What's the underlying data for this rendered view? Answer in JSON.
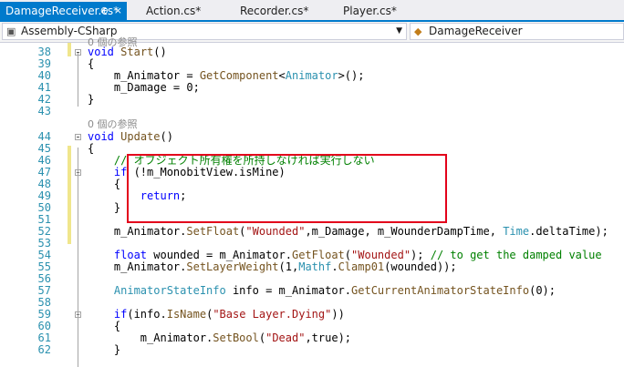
{
  "tabs": [
    {
      "label": "DamageReceiver.cs*",
      "active": true,
      "pin": "⊕",
      "close": "×"
    },
    {
      "label": "Action.cs*",
      "active": false
    },
    {
      "label": "Recorder.cs*",
      "active": false
    },
    {
      "label": "Player.cs*",
      "active": false
    }
  ],
  "nav": {
    "project": "Assembly-CSharp",
    "project_icon": "csharp-project-icon",
    "class": "DamageReceiver",
    "class_icon": "class-icon"
  },
  "colors": {
    "accent": "#007acc",
    "highlight_box": "#e3001b",
    "comment": "#008000",
    "keyword": "#0000ff",
    "type": "#2b91af",
    "string": "#a31515",
    "line_number": "#2b91af"
  },
  "editor": {
    "top_partial": "0 個の参照",
    "lines": [
      {
        "n": "38",
        "tokens": [
          {
            "t": "void",
            "c": "kw"
          },
          {
            "t": " "
          },
          {
            "t": "Start",
            "c": "mt"
          },
          {
            "t": "()"
          }
        ]
      },
      {
        "n": "39",
        "tokens": [
          {
            "t": "{"
          }
        ]
      },
      {
        "n": "40",
        "tokens": [
          {
            "t": "    m_Animator = "
          },
          {
            "t": "GetComponent",
            "c": "mt"
          },
          {
            "t": "<"
          },
          {
            "t": "Animator",
            "c": "ty"
          },
          {
            "t": ">();"
          }
        ]
      },
      {
        "n": "41",
        "tokens": [
          {
            "t": "    m_Damage = 0;"
          }
        ]
      },
      {
        "n": "42",
        "tokens": [
          {
            "t": "}"
          }
        ]
      },
      {
        "n": "43",
        "tokens": []
      },
      {
        "n": "",
        "ref": "0 個の参照"
      },
      {
        "n": "44",
        "tokens": [
          {
            "t": "void",
            "c": "kw"
          },
          {
            "t": " "
          },
          {
            "t": "Update",
            "c": "mt"
          },
          {
            "t": "()"
          }
        ]
      },
      {
        "n": "45",
        "tokens": [
          {
            "t": "{"
          }
        ]
      },
      {
        "n": "46",
        "tokens": [
          {
            "t": "    "
          },
          {
            "t": "// オブジェクト所有権を所持しなければ実行しない",
            "c": "cm"
          }
        ]
      },
      {
        "n": "47",
        "tokens": [
          {
            "t": "    "
          },
          {
            "t": "if",
            "c": "kw"
          },
          {
            "t": " (!m_MonobitView.isMine)"
          }
        ]
      },
      {
        "n": "48",
        "tokens": [
          {
            "t": "    {"
          }
        ]
      },
      {
        "n": "49",
        "tokens": [
          {
            "t": "        "
          },
          {
            "t": "return",
            "c": "kw"
          },
          {
            "t": ";"
          }
        ]
      },
      {
        "n": "50",
        "tokens": [
          {
            "t": "    }"
          }
        ]
      },
      {
        "n": "51",
        "tokens": []
      },
      {
        "n": "52",
        "tokens": [
          {
            "t": "    m_Animator."
          },
          {
            "t": "SetFloat",
            "c": "mt"
          },
          {
            "t": "("
          },
          {
            "t": "\"Wounded\"",
            "c": "st"
          },
          {
            "t": ",m_Damage, m_WounderDampTime, "
          },
          {
            "t": "Time",
            "c": "ty"
          },
          {
            "t": ".deltaTime);"
          }
        ]
      },
      {
        "n": "53",
        "tokens": []
      },
      {
        "n": "54",
        "tokens": [
          {
            "t": "    "
          },
          {
            "t": "float",
            "c": "kw"
          },
          {
            "t": " wounded = m_Animator."
          },
          {
            "t": "GetFloat",
            "c": "mt"
          },
          {
            "t": "("
          },
          {
            "t": "\"Wounded\"",
            "c": "st"
          },
          {
            "t": "); "
          },
          {
            "t": "// to get the damped value",
            "c": "cm"
          }
        ]
      },
      {
        "n": "55",
        "tokens": [
          {
            "t": "    m_Animator."
          },
          {
            "t": "SetLayerWeight",
            "c": "mt"
          },
          {
            "t": "(1,"
          },
          {
            "t": "Mathf",
            "c": "ty"
          },
          {
            "t": "."
          },
          {
            "t": "Clamp01",
            "c": "mt"
          },
          {
            "t": "(wounded));"
          }
        ]
      },
      {
        "n": "56",
        "tokens": []
      },
      {
        "n": "57",
        "tokens": [
          {
            "t": "    "
          },
          {
            "t": "AnimatorStateInfo",
            "c": "ty"
          },
          {
            "t": " info = m_Animator."
          },
          {
            "t": "GetCurrentAnimatorStateInfo",
            "c": "mt"
          },
          {
            "t": "(0);"
          }
        ]
      },
      {
        "n": "58",
        "tokens": []
      },
      {
        "n": "59",
        "tokens": [
          {
            "t": "    "
          },
          {
            "t": "if",
            "c": "kw"
          },
          {
            "t": "(info."
          },
          {
            "t": "IsName",
            "c": "mt"
          },
          {
            "t": "("
          },
          {
            "t": "\"Base Layer.Dying\"",
            "c": "st"
          },
          {
            "t": "))"
          }
        ]
      },
      {
        "n": "60",
        "tokens": [
          {
            "t": "    {"
          }
        ]
      },
      {
        "n": "61",
        "tokens": [
          {
            "t": "        m_Animator."
          },
          {
            "t": "SetBool",
            "c": "mt"
          },
          {
            "t": "("
          },
          {
            "t": "\"Dead\"",
            "c": "st"
          },
          {
            "t": ",true);"
          }
        ]
      },
      {
        "n": "62",
        "tokens": [
          {
            "t": "    }"
          }
        ]
      }
    ]
  }
}
